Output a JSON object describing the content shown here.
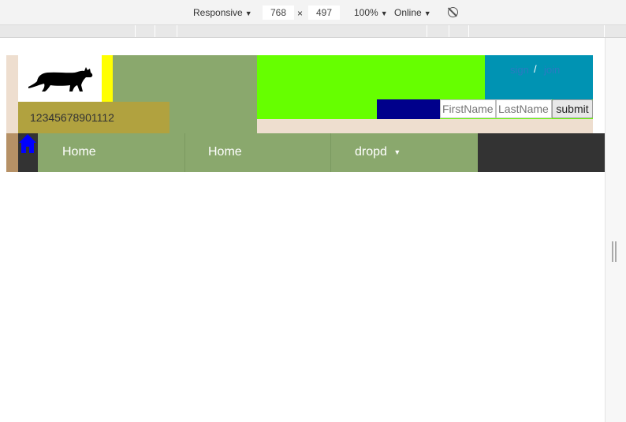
{
  "devtools": {
    "device_mode": "Responsive",
    "width": "768",
    "times": "×",
    "height": "497",
    "zoom": "100%",
    "network": "Online"
  },
  "header": {
    "phone": "12345678901112",
    "links": {
      "first": "sign",
      "sep": "/",
      "second": "join"
    }
  },
  "form": {
    "firstname_placeholder": "FirstName",
    "lastname_placeholder": "LastName",
    "submit_label": "submit"
  },
  "nav": {
    "items": [
      {
        "label": "Home"
      },
      {
        "label": "Home"
      },
      {
        "label": "dropd"
      }
    ]
  },
  "colors": {
    "header_green": "#8aa86d",
    "bright_green": "#66ff00",
    "teal": "#0093b3",
    "navy": "#00008b",
    "olive": "#b1a23f",
    "yellow": "#ffff00",
    "beige": "#eedecf",
    "nav_dark": "#333333",
    "home_blue": "#0000ff"
  }
}
